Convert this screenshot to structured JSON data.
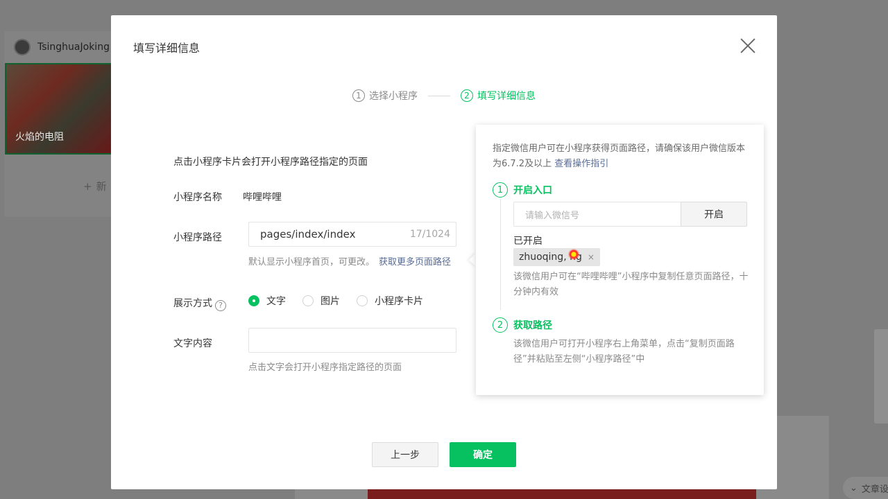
{
  "background": {
    "username": "TsinghuaJoking",
    "article_title": "火焰的电阻",
    "add_label": "新",
    "bottom_right_text": "文章设"
  },
  "dialog": {
    "title": "填写详细信息",
    "steps": [
      {
        "num": "1",
        "label": "选择小程序"
      },
      {
        "num": "2",
        "label": "填写详细信息"
      }
    ],
    "description": "点击小程序卡片会打开小程序路径指定的页面",
    "name_label": "小程序名称",
    "name_value": "哔哩哔哩",
    "path_label": "小程序路径",
    "path_value": "pages/index/index",
    "path_counter": "17/1024",
    "path_tip": "默认显示小程序首页，可更改。",
    "path_tip_link": "获取更多页面路径",
    "display_label": "展示方式",
    "display_help_icon": "?",
    "display_options": [
      {
        "label": "文字",
        "checked": true
      },
      {
        "label": "图片",
        "checked": false
      },
      {
        "label": "小程序卡片",
        "checked": false
      }
    ],
    "text_label": "文字内容",
    "text_value": "",
    "text_tip": "点击文字会打开小程序指定路径的页面",
    "prev_button": "上一步",
    "ok_button": "确定"
  },
  "popover": {
    "intro": "指定微信用户可在小程序获得页面路径，请确保该用户微信版本为6.7.2及以上",
    "intro_link": "查看操作指引",
    "step1_num": "1",
    "step1_title": "开启入口",
    "wechat_placeholder": "请输入微信号",
    "open_button": "开启",
    "opened_label": "已开启",
    "opened_tag": "zhuoqing,  ng",
    "tag_close": "×",
    "step1_note": "该微信用户可在“哔哩哔哩”小程序中复制任意页面路径，十分钟内有效",
    "step2_num": "2",
    "step2_title": "获取路径",
    "step2_note": "该微信用户可打开小程序右上角菜单，点击“复制页面路径”并粘贴至左侧“小程序路径”中"
  },
  "colors": {
    "accent": "#07c160",
    "link": "#576b95",
    "overlay": "#7e7e7e"
  }
}
